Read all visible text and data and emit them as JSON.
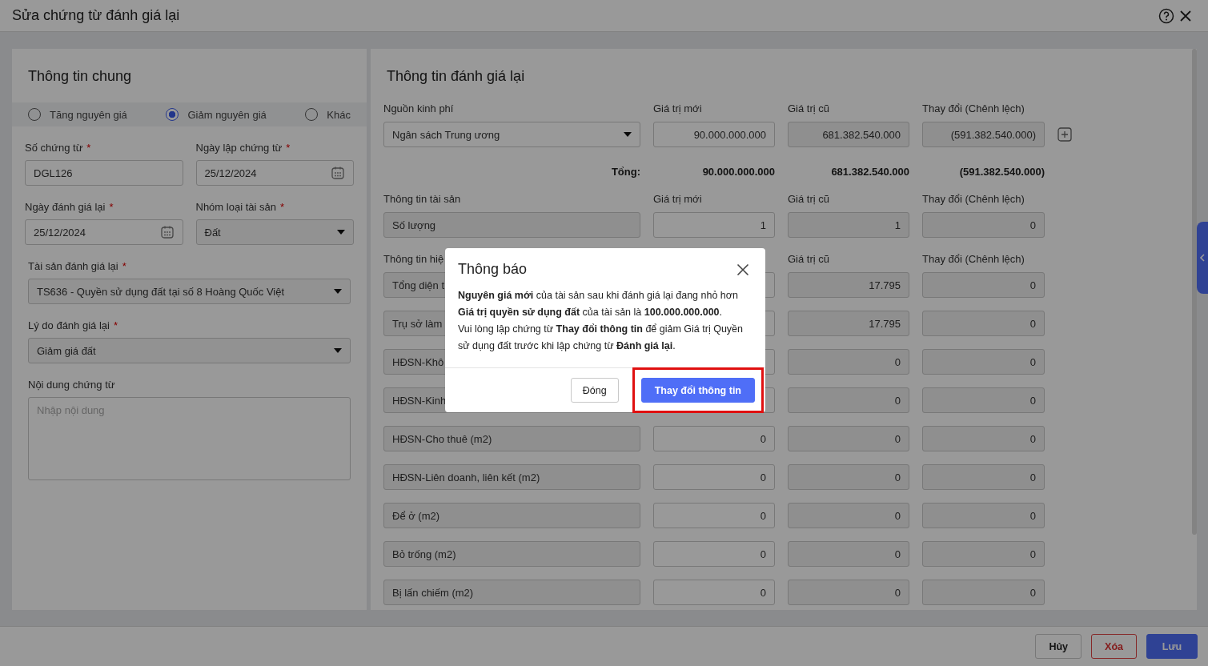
{
  "window": {
    "title": "Sửa chứng từ đánh giá lại"
  },
  "general": {
    "title": "Thông tin chung",
    "types": [
      {
        "label": "Tăng nguyên giá",
        "selected": false
      },
      {
        "label": "Giảm nguyên giá",
        "selected": true
      },
      {
        "label": "Khác",
        "selected": false
      }
    ],
    "pair_fields": [
      {
        "label": "Số chứng từ",
        "required_mark": "*",
        "kind": "text",
        "value": "DGL126"
      },
      {
        "label": "Ngày lập chứng từ",
        "required_mark": "*",
        "kind": "date",
        "value": "25/12/2024"
      },
      {
        "label": "Ngày đánh giá lại",
        "required_mark": "*",
        "kind": "date",
        "value": "25/12/2024"
      },
      {
        "label": "Nhóm loại tài sản",
        "required_mark": "*",
        "kind": "select",
        "value": "Đất"
      }
    ],
    "fields": [
      {
        "label": "Tài sản đánh giá lại",
        "required_mark": "*",
        "kind": "select",
        "value": "TS636 - Quyền sử dụng đất tại số 8 Hoàng Quốc Việt"
      },
      {
        "label": "Lý do đánh giá lại",
        "required_mark": "*",
        "kind": "select",
        "value": "Giảm giá đất"
      },
      {
        "label": "Nội dung chứng từ",
        "kind": "textarea",
        "placeholder": "Nhập nội dung"
      }
    ]
  },
  "revaluation": {
    "title": "Thông tin đánh giá lại",
    "funding": {
      "headers": {
        "label": "Nguồn kinh phí",
        "new": "Giá trị mới",
        "old": "Giá trị cũ",
        "diff": "Thay đổi (Chênh lệch)"
      },
      "rows": [
        {
          "label": "Ngân sách Trung ương",
          "new": "90.000.000.000",
          "old": "681.382.540.000",
          "diff": "(591.382.540.000)"
        }
      ],
      "total": {
        "label": "Tổng:",
        "new": "90.000.000.000",
        "old": "681.382.540.000",
        "diff": "(591.382.540.000)"
      }
    },
    "asset": {
      "headers": {
        "label": "Thông tin tài sản",
        "new": "Giá trị mới",
        "old": "Giá trị cũ",
        "diff": "Thay đổi (Chênh lệch)"
      },
      "rows": [
        {
          "label": "Số lượng",
          "new": "1",
          "old": "1",
          "diff": "0"
        }
      ]
    },
    "usage": {
      "headers": {
        "label": "Thông tin hiệ",
        "old": "Giá trị cũ",
        "diff": "Thay đổi (Chênh lệch)"
      },
      "rows": [
        {
          "label": "Tổng diện t",
          "old": "17.795",
          "diff": "0"
        },
        {
          "label": "Trụ sở làm",
          "old": "17.795",
          "diff": "0"
        },
        {
          "label": "HĐSN-Khô",
          "old": "0",
          "diff": "0"
        },
        {
          "label": "HĐSN-Kinh",
          "old": "0",
          "diff": "0"
        },
        {
          "label": "HĐSN-Cho thuê (m2)",
          "new": "0",
          "old": "0",
          "diff": "0"
        },
        {
          "label": "HĐSN-Liên doanh, liên kết (m2)",
          "new": "0",
          "old": "0",
          "diff": "0"
        },
        {
          "label": "Để ở (m2)",
          "new": "0",
          "old": "0",
          "diff": "0"
        },
        {
          "label": "Bỏ trống (m2)",
          "new": "0",
          "old": "0",
          "diff": "0"
        },
        {
          "label": "Bị lấn chiếm (m2)",
          "new": "0",
          "old": "0",
          "diff": "0"
        }
      ]
    }
  },
  "footer": {
    "buttons": [
      {
        "label": "Hủy",
        "kind": "default"
      },
      {
        "label": "Xóa",
        "kind": "danger"
      },
      {
        "label": "Lưu",
        "kind": "primary"
      }
    ]
  },
  "dialog": {
    "title": "Thông báo",
    "message": [
      "**Nguyên giá mới** của tài sản sau khi đánh giá lại đang nhỏ hơn **Giá trị quyền sử dụng đất** của tài sản là **100.000.000.000**.",
      "Vui lòng lập chứng từ **Thay đổi thông tin** để giảm Giá trị Quyền sử dụng đất trước khi lập chứng từ **Đánh giá lại**."
    ],
    "buttons": [
      {
        "label": "Đóng",
        "kind": "default"
      },
      {
        "label": "Thay đổi thông tin",
        "kind": "primary",
        "highlighted": true
      }
    ]
  }
}
